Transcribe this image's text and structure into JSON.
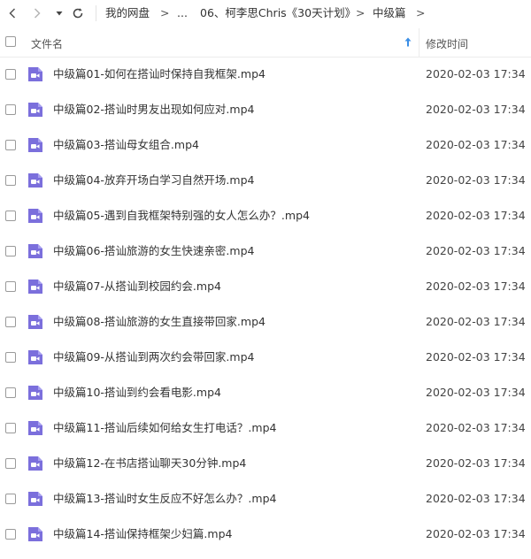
{
  "breadcrumb": {
    "items": [
      "我的网盘",
      "...",
      "06、柯李思Chris《30天计划》",
      "中级篇"
    ]
  },
  "header": {
    "name_label": "文件名",
    "time_label": "修改时间"
  },
  "colors": {
    "video_icon": "#7b6fdc",
    "sort_arrow": "#3a8ee6"
  },
  "files": [
    {
      "name": "中级篇01-如何在搭讪时保持自我框架.mp4",
      "time": "2020-02-03 17:34"
    },
    {
      "name": "中级篇02-搭讪时男友出现如何应对.mp4",
      "time": "2020-02-03 17:34"
    },
    {
      "name": "中级篇03-搭讪母女组合.mp4",
      "time": "2020-02-03 17:34"
    },
    {
      "name": "中级篇04-放弃开场白学习自然开场.mp4",
      "time": "2020-02-03 17:34"
    },
    {
      "name": "中级篇05-遇到自我框架特别强的女人怎么办？.mp4",
      "time": "2020-02-03 17:34"
    },
    {
      "name": "中级篇06-搭讪旅游的女生快速亲密.mp4",
      "time": "2020-02-03 17:34"
    },
    {
      "name": "中级篇07-从搭讪到校园约会.mp4",
      "time": "2020-02-03 17:34"
    },
    {
      "name": "中级篇08-搭讪旅游的女生直接带回家.mp4",
      "time": "2020-02-03 17:34"
    },
    {
      "name": "中级篇09-从搭讪到两次约会带回家.mp4",
      "time": "2020-02-03 17:34"
    },
    {
      "name": "中级篇10-搭讪到约会看电影.mp4",
      "time": "2020-02-03 17:34"
    },
    {
      "name": "中级篇11-搭讪后续如何给女生打电话？.mp4",
      "time": "2020-02-03 17:34"
    },
    {
      "name": "中级篇12-在书店搭讪聊天30分钟.mp4",
      "time": "2020-02-03 17:34"
    },
    {
      "name": "中级篇13-搭讪时女生反应不好怎么办？.mp4",
      "time": "2020-02-03 17:34"
    },
    {
      "name": "中级篇14-搭讪保持框架少妇篇.mp4",
      "time": "2020-02-03 17:34"
    }
  ]
}
